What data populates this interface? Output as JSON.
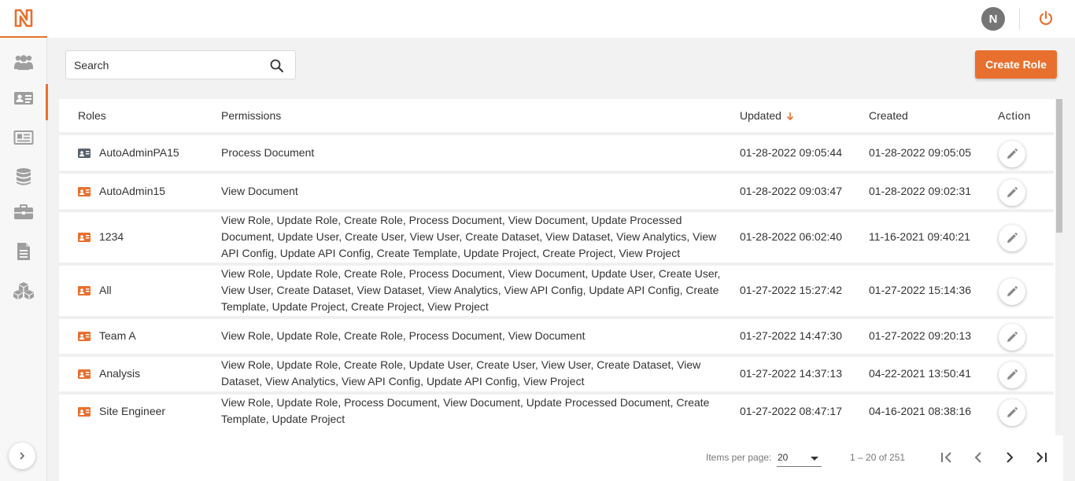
{
  "app": {
    "logo_letter": "N",
    "accent": "#e8702f"
  },
  "sidebar": {
    "items": [
      {
        "icon": "users-icon"
      },
      {
        "icon": "id-card-icon",
        "active": true
      },
      {
        "icon": "newspaper-icon"
      },
      {
        "icon": "database-icon"
      },
      {
        "icon": "briefcase-icon"
      },
      {
        "icon": "document-icon"
      },
      {
        "icon": "cubes-icon"
      }
    ],
    "expand_icon": "chevron-right-icon"
  },
  "topbar": {
    "avatar_initial": "N",
    "power_icon": "power-icon"
  },
  "search": {
    "placeholder": "Search",
    "value": ""
  },
  "create_button_label": "Create Role",
  "table": {
    "headers": {
      "roles": "Roles",
      "permissions": "Permissions",
      "updated": "Updated",
      "created": "Created",
      "action": "Action"
    },
    "sort_column": "updated",
    "sort_direction": "descending",
    "rows": [
      {
        "role": "AutoAdminPA15",
        "icon_color": "#5a6370",
        "permissions": "Process Document",
        "updated": "01-28-2022 09:05:44",
        "created": "01-28-2022 09:05:05"
      },
      {
        "role": "AutoAdmin15",
        "icon_color": "#e8702f",
        "permissions": "View Document",
        "updated": "01-28-2022 09:03:47",
        "created": "01-28-2022 09:02:31"
      },
      {
        "role": "1234",
        "icon_color": "#e8702f",
        "permissions": "View Role, Update Role, Create Role, Process Document, View Document, Update Processed Document, Update User, Create User, View User, Create Dataset, View Dataset, View Analytics, View API Config, Update API Config, Create Template, Update Project, Create Project, View Project",
        "updated": "01-28-2022 06:02:40",
        "created": "11-16-2021 09:40:21"
      },
      {
        "role": "All",
        "icon_color": "#e8702f",
        "permissions": "View Role, Update Role, Create Role, Process Document, View Document, Update User, Create User, View User, Create Dataset, View Dataset, View Analytics, View API Config, Update API Config, Create Template, Update Project, Create Project, View Project",
        "updated": "01-27-2022 15:27:42",
        "created": "01-27-2022 15:14:36"
      },
      {
        "role": "Team A",
        "icon_color": "#e8702f",
        "permissions": "View Role, Update Role, Create Role, Process Document, View Document",
        "updated": "01-27-2022 14:47:30",
        "created": "01-27-2022 09:20:13"
      },
      {
        "role": "Analysis",
        "icon_color": "#e8702f",
        "permissions": "View Role, Update Role, Create Role, Update User, Create User, View User, Create Dataset, View Dataset, View Analytics, View API Config, Update API Config, View Project",
        "updated": "01-27-2022 14:37:13",
        "created": "04-22-2021 13:50:41"
      },
      {
        "role": "Site Engineer",
        "icon_color": "#e8702f",
        "permissions": "View Role, Update Role, Process Document, View Document, Update Processed Document, Create Template, Update Project",
        "updated": "01-27-2022 08:47:17",
        "created": "04-16-2021 08:38:16"
      }
    ],
    "edit_icon": "pencil-icon"
  },
  "paginator": {
    "items_per_page_label": "Items per page:",
    "items_per_page_value": "20",
    "range_label": "1 – 20 of 251"
  }
}
